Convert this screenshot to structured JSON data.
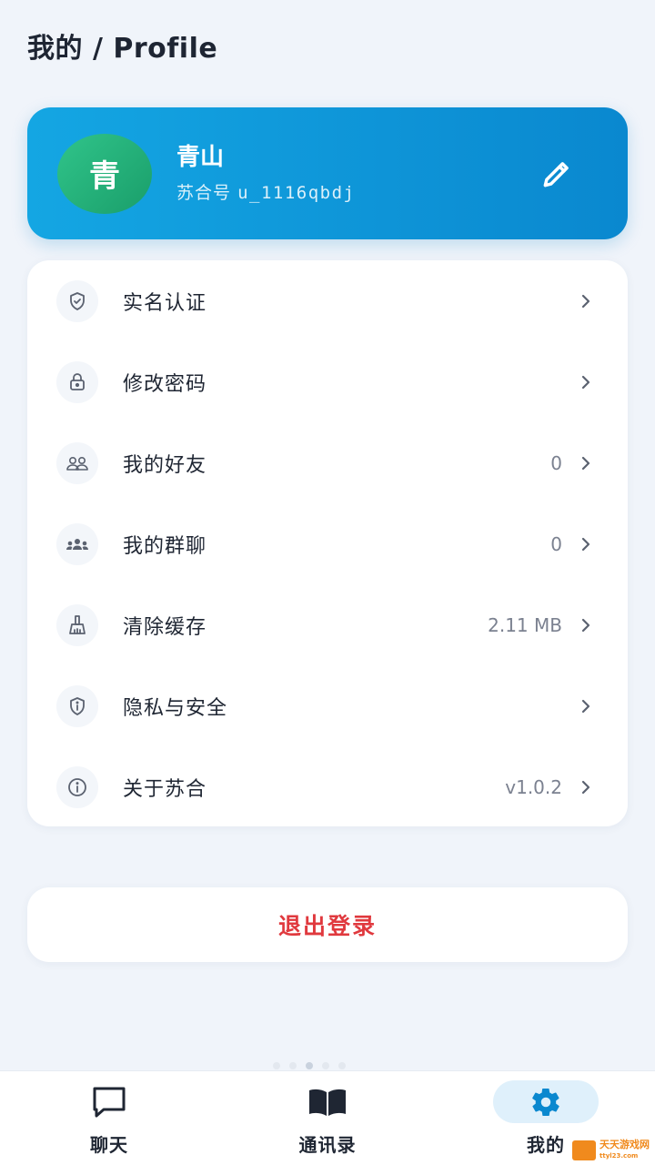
{
  "header": {
    "title": "我的 / Profile"
  },
  "profile": {
    "avatar_char": "青",
    "name": "青山",
    "id_label": "苏合号",
    "id_value": "u_1116qbdj"
  },
  "menu": [
    {
      "label": "实名认证",
      "value": "",
      "icon": "shield-check-icon"
    },
    {
      "label": "修改密码",
      "value": "",
      "icon": "lock-icon"
    },
    {
      "label": "我的好友",
      "value": "0",
      "icon": "friends-icon"
    },
    {
      "label": "我的群聊",
      "value": "0",
      "icon": "group-icon"
    },
    {
      "label": "清除缓存",
      "value": "2.11 MB",
      "icon": "broom-icon"
    },
    {
      "label": "隐私与安全",
      "value": "",
      "icon": "shield-info-icon"
    },
    {
      "label": "关于苏合",
      "value": "v1.0.2",
      "icon": "info-icon"
    }
  ],
  "logout_label": "退出登录",
  "tabs": [
    {
      "label": "聊天",
      "icon": "chat-icon",
      "active": false
    },
    {
      "label": "通讯录",
      "icon": "book-icon",
      "active": false
    },
    {
      "label": "我的",
      "icon": "gear-icon",
      "active": true
    }
  ],
  "watermark": {
    "text": "天天游戏网",
    "sub": "ttyl23.com"
  },
  "colors": {
    "accent": "#0a88cf",
    "avatar": "#1a9e6a",
    "logout": "#e0393e",
    "background": "#f0f4fa"
  }
}
